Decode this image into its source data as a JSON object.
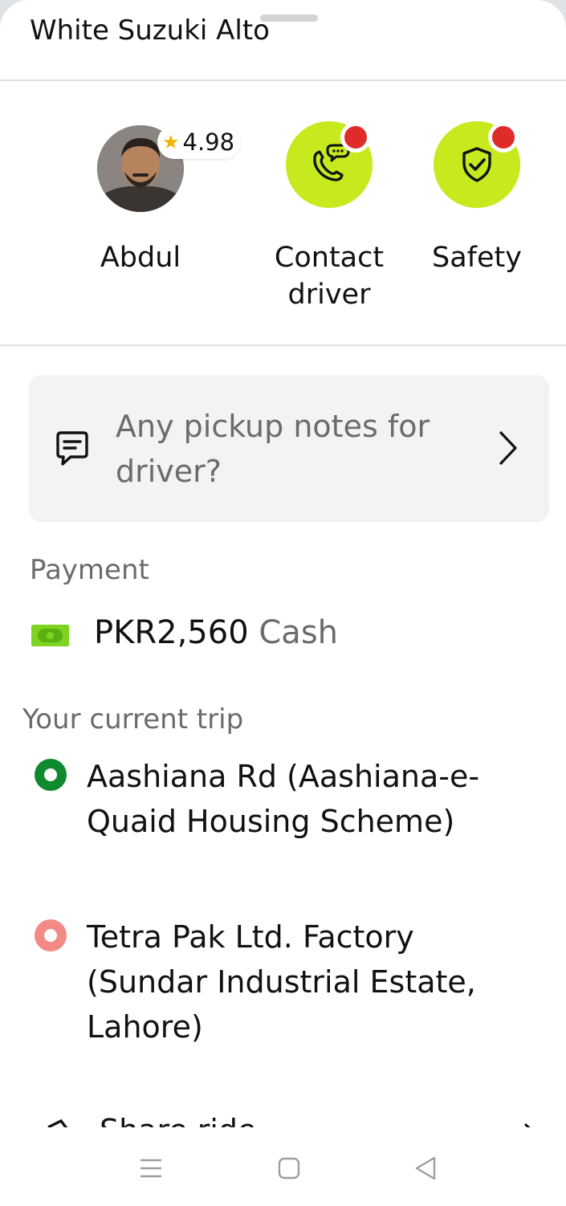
{
  "header": {
    "vehicle": "White Suzuki Alto"
  },
  "driver": {
    "name": "Abdul",
    "rating": "4.98"
  },
  "actions": [
    {
      "label": "Contact driver",
      "icon": "phone-chat-icon"
    },
    {
      "label": "Safety",
      "icon": "shield-check-icon"
    }
  ],
  "notes": {
    "placeholder": "Any pickup notes for driver?"
  },
  "payment": {
    "label": "Payment",
    "amount": "PKR2,560",
    "method": "Cash"
  },
  "trip": {
    "label": "Your current trip",
    "pickup": "Aashiana Rd (Aashiana-e-Quaid Housing Scheme)",
    "dropoff": "Tetra Pak Ltd. Factory (Sundar Industrial Estate, Lahore)"
  },
  "partial_row": {
    "text": "Share ride"
  },
  "colors": {
    "accent": "#c6ea1e",
    "pickup": "#0f8a2e",
    "dropoff": "#f48a84",
    "badge": "#e02b2b"
  }
}
